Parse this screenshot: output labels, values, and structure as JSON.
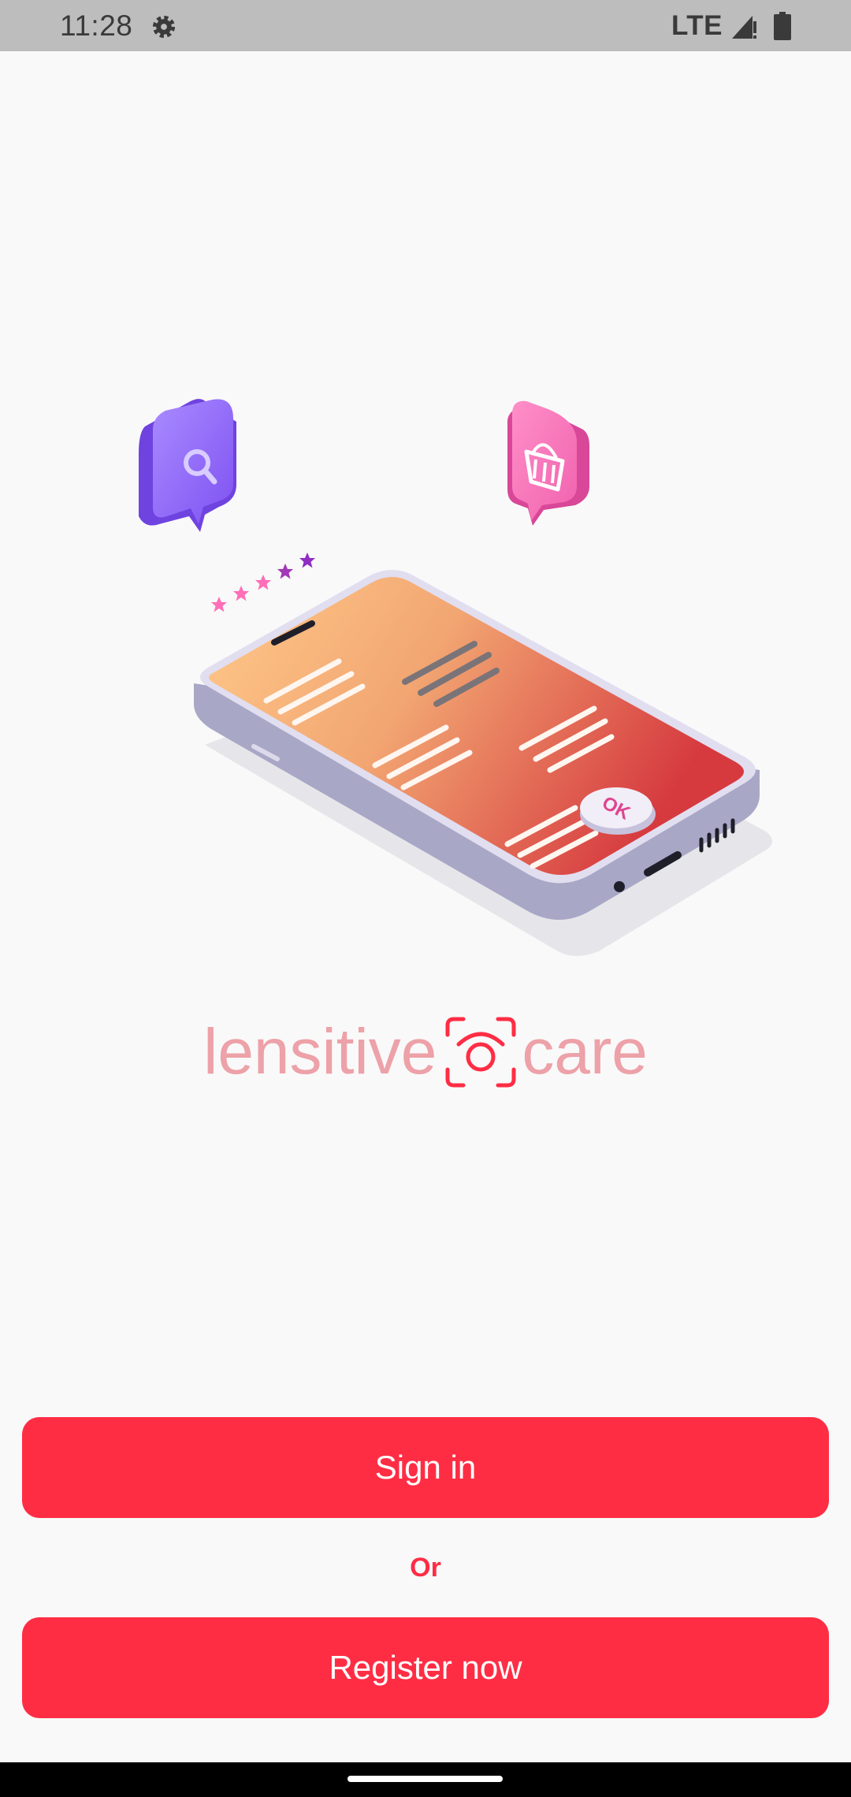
{
  "status_bar": {
    "time": "11:28",
    "network": "LTE",
    "icons": [
      "gear-icon",
      "signal-icon",
      "battery-icon"
    ]
  },
  "hero": {
    "icons": [
      "search-bubble-icon",
      "basket-bubble-icon",
      "rating-stars-icon",
      "phone-illustration"
    ],
    "ok_badge": "OK"
  },
  "brand": {
    "name_left": "lensitive",
    "name_right": "care",
    "icon": "camera-scan-icon",
    "text_color": "#eda1a8",
    "icon_color": "#ff2d44"
  },
  "actions": {
    "sign_in_label": "Sign in",
    "or_label": "Or",
    "register_label": "Register now"
  },
  "colors": {
    "accent": "#ff2d44",
    "background": "#f9f9f9"
  }
}
